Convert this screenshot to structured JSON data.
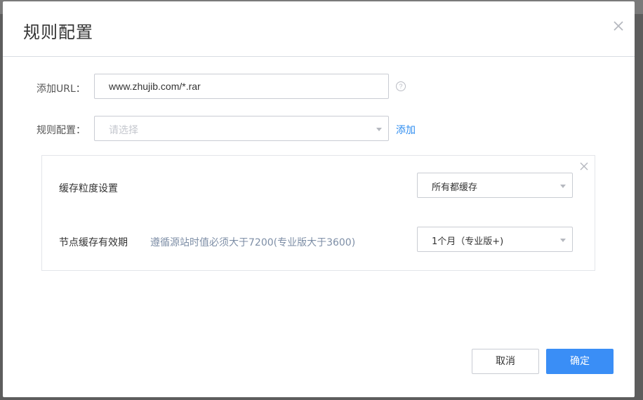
{
  "dialog": {
    "title": "规则配置",
    "url_label": "添加URL：",
    "url_value": "www.zhujib.com/*.rar",
    "help_icon": "question-circle-icon",
    "rule_label": "规则配置：",
    "rule_placeholder": "请选择",
    "add_link": "添加",
    "panel": {
      "granularity_label": "缓存粒度设置",
      "granularity_value": "所有都缓存",
      "ttl_label": "节点缓存有效期",
      "ttl_hint": "遵循源站时值必须大于7200(专业版大于3600)",
      "ttl_value": "1个月（专业版+)"
    },
    "cancel_label": "取消",
    "ok_label": "确定"
  },
  "colors": {
    "accent": "#3a8ef6",
    "link": "#2d8cf0",
    "hint": "#7d8ea6"
  }
}
